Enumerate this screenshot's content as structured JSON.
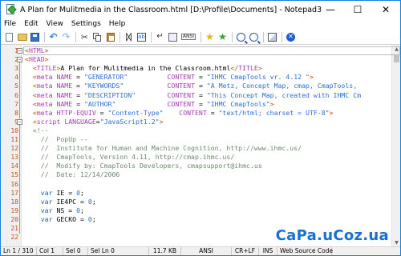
{
  "window": {
    "title": "A Plan for Mulitmedia in the Classroom.html [D:\\Profile\\Documents] - Notepad3",
    "controls": {
      "minimize": "—",
      "maximize": "☐",
      "close": "✕"
    }
  },
  "menu": [
    "File",
    "Edit",
    "View",
    "Settings",
    "Help"
  ],
  "toolbar": {
    "encoding_label": "ANSI",
    "buttons": [
      "new-document",
      "open-folder",
      "save",
      "undo",
      "redo",
      "cut",
      "copy",
      "paste",
      "find",
      "replace",
      "word-wrap",
      "show-whitespace",
      "encoding-ansi",
      "add-favorite",
      "favorites",
      "zoom-in",
      "zoom-out",
      "scheme",
      "close-file"
    ]
  },
  "editor": {
    "line_numbers": [
      "1",
      "2",
      "3",
      "4",
      "5",
      "6",
      "7",
      "8",
      "9",
      "10",
      "11",
      "12",
      "13",
      "14",
      "15",
      "16",
      "17",
      "18",
      "19",
      "20",
      "21",
      "22"
    ],
    "lines": [
      [
        [
          "tag",
          "<"
        ],
        [
          "el",
          "HTML"
        ],
        [
          "tag",
          ">"
        ]
      ],
      [
        [
          "tag",
          "<"
        ],
        [
          "el",
          "HEAD"
        ],
        [
          "tag",
          ">"
        ]
      ],
      [
        [
          "plain",
          "  "
        ],
        [
          "tag",
          "<"
        ],
        [
          "el",
          "TITLE"
        ],
        [
          "tag",
          ">"
        ],
        [
          "plain",
          "A Plan for Mulitmedia in the Classroom.html"
        ],
        [
          "tag",
          "</"
        ],
        [
          "el",
          "TITLE"
        ],
        [
          "tag",
          ">"
        ]
      ],
      [
        [
          "plain",
          "  "
        ],
        [
          "tag",
          "<"
        ],
        [
          "el",
          "meta "
        ],
        [
          "attr",
          "NAME"
        ],
        [
          "plain",
          " = "
        ],
        [
          "str",
          "\"GENERATOR\""
        ],
        [
          "plain",
          "          "
        ],
        [
          "attr",
          "CONTENT"
        ],
        [
          "plain",
          " = "
        ],
        [
          "str",
          "\"IHMC CmapTools vr. 4.12 \""
        ],
        [
          "tag",
          ">"
        ]
      ],
      [
        [
          "plain",
          "  "
        ],
        [
          "tag",
          "<"
        ],
        [
          "el",
          "meta "
        ],
        [
          "attr",
          "NAME"
        ],
        [
          "plain",
          " = "
        ],
        [
          "str",
          "\"KEYWORDS\""
        ],
        [
          "plain",
          "           "
        ],
        [
          "attr",
          "CONTENT"
        ],
        [
          "plain",
          " = "
        ],
        [
          "str",
          "\"A Metz, Concept Map, cmap, CmapTools,"
        ]
      ],
      [
        [
          "plain",
          "  "
        ],
        [
          "tag",
          "<"
        ],
        [
          "el",
          "meta "
        ],
        [
          "attr",
          "NAME"
        ],
        [
          "plain",
          " = "
        ],
        [
          "str",
          "\"DESCRIPTION\""
        ],
        [
          "plain",
          "        "
        ],
        [
          "attr",
          "CONTENT"
        ],
        [
          "plain",
          " = "
        ],
        [
          "str",
          "\"This Concept Map, created with IHMC Cm"
        ]
      ],
      [
        [
          "plain",
          "  "
        ],
        [
          "tag",
          "<"
        ],
        [
          "el",
          "meta "
        ],
        [
          "attr",
          "NAME"
        ],
        [
          "plain",
          " = "
        ],
        [
          "str",
          "\"AUTHOR\""
        ],
        [
          "plain",
          "             "
        ],
        [
          "attr",
          "CONTENT"
        ],
        [
          "plain",
          " = "
        ],
        [
          "str",
          "\"IHMC CmapTools\""
        ],
        [
          "tag",
          ">"
        ]
      ],
      [
        [
          "plain",
          "  "
        ],
        [
          "tag",
          "<"
        ],
        [
          "el",
          "meta "
        ],
        [
          "attr",
          "HTTP-EQUIV"
        ],
        [
          "plain",
          " = "
        ],
        [
          "str",
          "\"Content-Type\""
        ],
        [
          "plain",
          "    "
        ],
        [
          "attr",
          "CONTENT"
        ],
        [
          "plain",
          " = "
        ],
        [
          "str",
          "\"text/html; charset = UTF-8\""
        ],
        [
          "tag",
          ">"
        ]
      ],
      [
        [
          "plain",
          "  "
        ],
        [
          "tag",
          "<"
        ],
        [
          "el",
          "script "
        ],
        [
          "attr",
          "LANGUAGE"
        ],
        [
          "plain",
          "="
        ],
        [
          "str",
          "\"JavaScript1.2\""
        ],
        [
          "tag",
          ">"
        ]
      ],
      [
        [
          "plain",
          "  "
        ],
        [
          "com",
          "<!--"
        ]
      ],
      [
        [
          "plain",
          "    "
        ],
        [
          "com",
          "//  PopUp --"
        ]
      ],
      [
        [
          "plain",
          "    "
        ],
        [
          "com",
          "//  Institute for Human and Machine Cognition, http://www.ihmc.us/"
        ]
      ],
      [
        [
          "plain",
          "    "
        ],
        [
          "com",
          "//  CmapTools, Version 4.11, http://cmap.ihmc.us/"
        ]
      ],
      [
        [
          "plain",
          "    "
        ],
        [
          "com",
          "//  Modify by: CmapTools Developers, cmapsupport@ihmc.us"
        ]
      ],
      [
        [
          "plain",
          "    "
        ],
        [
          "com",
          "//  Date: 12/14/2006"
        ]
      ],
      [
        [
          "plain",
          ""
        ]
      ],
      [
        [
          "plain",
          "    "
        ],
        [
          "kw",
          "var"
        ],
        [
          "plain",
          " IE = "
        ],
        [
          "str",
          "0"
        ],
        [
          "plain",
          ";"
        ]
      ],
      [
        [
          "plain",
          "    "
        ],
        [
          "kw",
          "var"
        ],
        [
          "plain",
          " IE4PC = "
        ],
        [
          "str",
          "0"
        ],
        [
          "plain",
          ";"
        ]
      ],
      [
        [
          "plain",
          "    "
        ],
        [
          "kw",
          "var"
        ],
        [
          "plain",
          " NS = "
        ],
        [
          "str",
          "0"
        ],
        [
          "plain",
          ";"
        ]
      ],
      [
        [
          "plain",
          "    "
        ],
        [
          "kw",
          "var"
        ],
        [
          "plain",
          " GECKO = "
        ],
        [
          "str",
          "0"
        ],
        [
          "plain",
          ";"
        ]
      ],
      [
        [
          "plain",
          ""
        ]
      ],
      [
        [
          "plain",
          ""
        ]
      ]
    ]
  },
  "status": {
    "ln": "Ln 1 / 310",
    "col": "Col 1",
    "sel": "Sel 0",
    "selln": "Sel Ln 0",
    "size": "11.7 KB",
    "encoding": "ANSI",
    "eol": "CR+LF",
    "ins": "INS",
    "scheme": "Web Source Code"
  },
  "watermark": "CaPa.uCoz.ua",
  "colors": {
    "tag": "#c8500a",
    "element": "#a53cb4",
    "string": "#2e6fd6",
    "comment": "#6c8a6c",
    "keyword": "#1f5fc0",
    "line_number": "#c8500a",
    "watermark": "#1a6fd1"
  }
}
